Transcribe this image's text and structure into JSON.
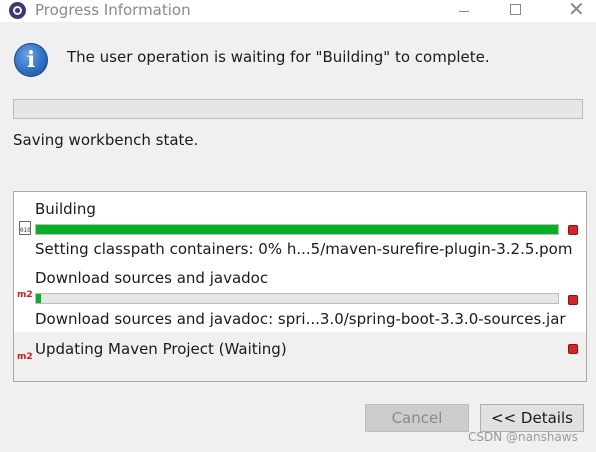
{
  "window": {
    "title": "Progress Information",
    "close_glyph": "✕"
  },
  "header": {
    "icon": "info-icon",
    "icon_glyph": "i",
    "message": "The user operation is waiting for \"Building\" to complete."
  },
  "main_progress": {
    "progress": 0
  },
  "status": "Saving workbench state.",
  "jobs": [
    {
      "name": "Building",
      "icon": "binary-file-icon",
      "icon_text": "010",
      "progress": 1.0,
      "detail": "Setting classpath containers: 0% h...5/maven-surefire-plugin-3.2.5.pom"
    },
    {
      "name": "Download sources and javadoc",
      "icon": "maven-m2-icon",
      "icon_text": "m2",
      "progress": 0.01,
      "detail": "Download sources and javadoc: spri...3.0/spring-boot-3.3.0-sources.jar"
    },
    {
      "name": "Updating Maven Project (Waiting)",
      "icon": "maven-m2-icon",
      "icon_text": "m2"
    }
  ],
  "buttons": {
    "cancel": "Cancel",
    "details": "<< Details"
  },
  "watermark": "CSDN @nanshaws",
  "colors": {
    "progress_green": "#06b025",
    "stop_red": "#d4252b",
    "m2_red": "#d11919"
  }
}
